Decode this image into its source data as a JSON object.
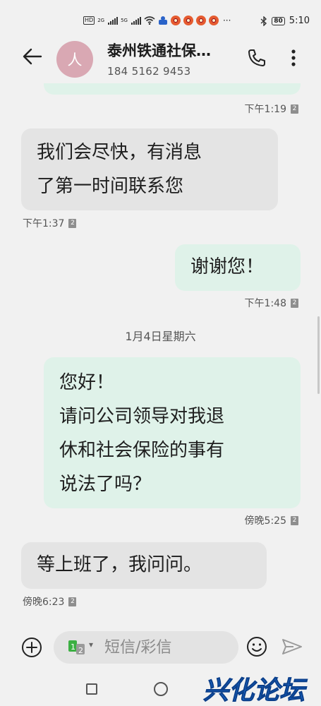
{
  "status_bar": {
    "hd_label": "HD",
    "sim1_label": "2G",
    "sim2_label": "5G",
    "more": "···",
    "battery": "80",
    "time": "5:10",
    "icons": [
      "hd-icon",
      "signal-icon",
      "wifi-icon",
      "app-notification-icon",
      "bluetooth-icon",
      "battery-icon"
    ]
  },
  "header": {
    "avatar_letter": "人",
    "contact_name": "泰州铁通社保…",
    "contact_number": "184 5162 9453"
  },
  "messages": [
    {
      "direction": "outgoing",
      "text": "",
      "time": "下午1:19",
      "sim": "2"
    },
    {
      "direction": "incoming",
      "lines": [
        "我们会尽快，有消息",
        "了第一时间联系您"
      ],
      "time": "下午1:37",
      "sim": "2"
    },
    {
      "direction": "outgoing",
      "lines": [
        "谢谢您！"
      ],
      "time": "下午1:48",
      "sim": "2"
    },
    {
      "direction": "outgoing",
      "lines": [
        "您好！",
        "请问公司领导对我退",
        "休和社会保险的事有",
        "说法了吗？"
      ],
      "time": "傍晚5:25",
      "sim": "2"
    },
    {
      "direction": "incoming",
      "lines": [
        "等上班了，我问问。"
      ],
      "time": "傍晚6:23",
      "sim": "2"
    }
  ],
  "date_separator": "1月4日星期六",
  "composer": {
    "placeholder": "短信/彩信",
    "sim_badge": "1",
    "sim_badge_2": "2"
  },
  "watermark": "兴化论坛",
  "colors": {
    "outgoing_bubble": "#dff2e9",
    "incoming_bubble": "#e4e4e4",
    "avatar": "#d9a8b3",
    "sim_green": "#3cb043",
    "watermark_blue": "#1f6fd6"
  }
}
